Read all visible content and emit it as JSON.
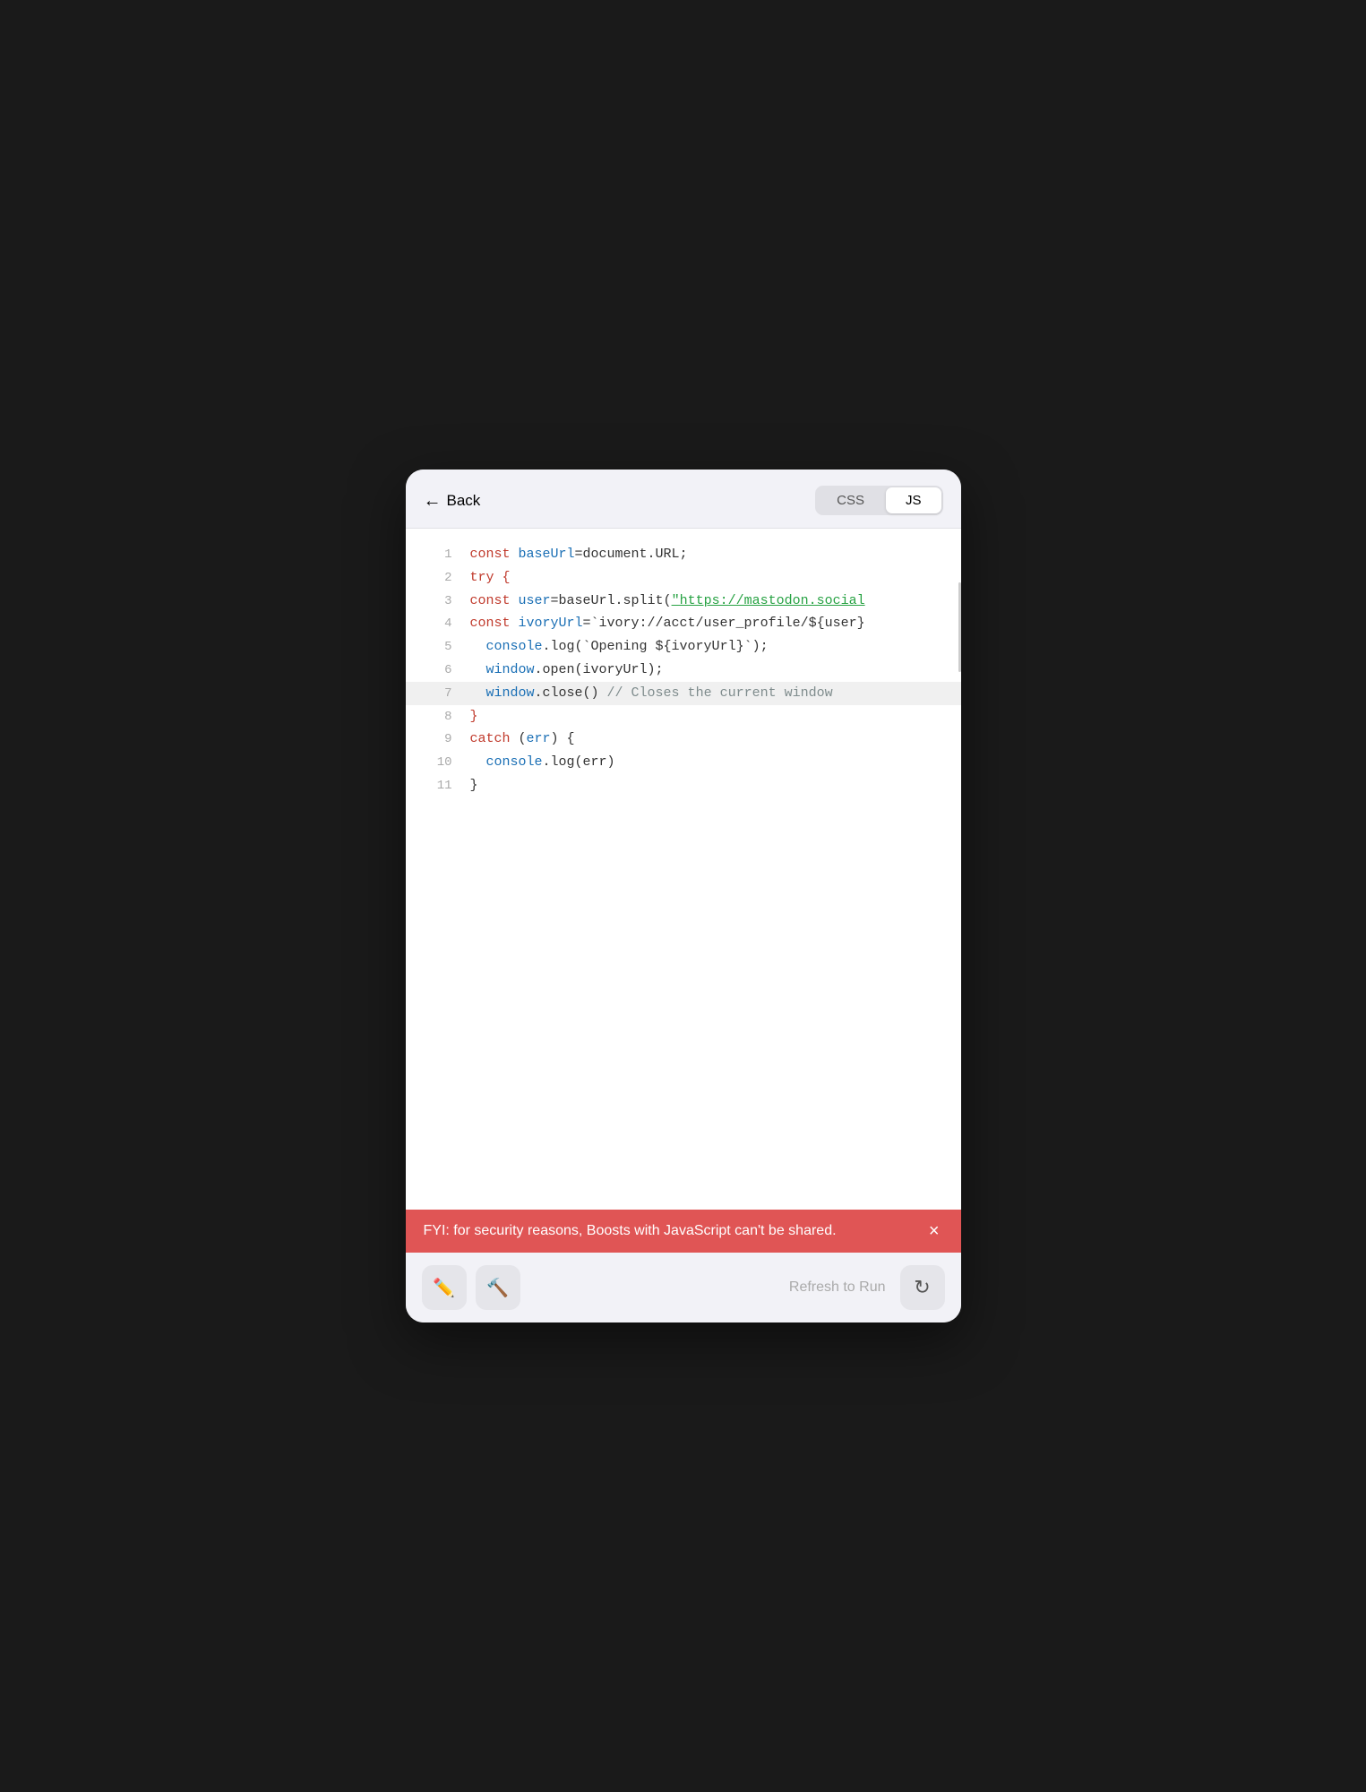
{
  "header": {
    "back_label": "Back",
    "tab_css": "CSS",
    "tab_js": "JS",
    "active_tab": "JS"
  },
  "code": {
    "lines": [
      {
        "num": "1",
        "tokens": [
          {
            "t": "kw-red",
            "v": "const "
          },
          {
            "t": "kw-blue",
            "v": "baseUrl"
          },
          {
            "t": "plain",
            "v": "=document.URL;"
          }
        ]
      },
      {
        "num": "2",
        "tokens": [
          {
            "t": "kw-red",
            "v": "try "
          },
          {
            "t": "brace",
            "v": "{"
          }
        ]
      },
      {
        "num": "3",
        "tokens": [
          {
            "t": "kw-red",
            "v": "const "
          },
          {
            "t": "kw-blue",
            "v": "user"
          },
          {
            "t": "plain",
            "v": "=baseUrl.split("
          },
          {
            "t": "string-green",
            "v": "\"https://mastodon.social"
          },
          {
            "t": "plain",
            "v": ""
          }
        ]
      },
      {
        "num": "4",
        "tokens": [
          {
            "t": "kw-red",
            "v": "const "
          },
          {
            "t": "kw-blue",
            "v": "ivoryUrl"
          },
          {
            "t": "plain",
            "v": "=`ivory://acct/user_profile/${user}"
          }
        ]
      },
      {
        "num": "5",
        "tokens": [
          {
            "t": "plain",
            "v": "  "
          },
          {
            "t": "kw-blue",
            "v": "console"
          },
          {
            "t": "plain",
            "v": ".log(`Opening ${ivoryUrl}`);"
          }
        ]
      },
      {
        "num": "6",
        "tokens": [
          {
            "t": "plain",
            "v": "  "
          },
          {
            "t": "kw-blue",
            "v": "window"
          },
          {
            "t": "plain",
            "v": ".open(ivoryUrl);"
          }
        ]
      },
      {
        "num": "7",
        "tokens": [
          {
            "t": "plain",
            "v": "  "
          },
          {
            "t": "kw-blue",
            "v": "window"
          },
          {
            "t": "plain",
            "v": ".close() "
          },
          {
            "t": "comment",
            "v": "// Closes the current window"
          }
        ],
        "highlighted": true
      },
      {
        "num": "8",
        "tokens": [
          {
            "t": "brace",
            "v": "}"
          }
        ]
      },
      {
        "num": "9",
        "tokens": [
          {
            "t": "kw-red",
            "v": "catch"
          },
          {
            "t": "plain",
            "v": " ("
          },
          {
            "t": "kw-blue",
            "v": "err"
          },
          {
            "t": "plain",
            "v": ") {"
          }
        ]
      },
      {
        "num": "10",
        "tokens": [
          {
            "t": "plain",
            "v": "  "
          },
          {
            "t": "kw-blue",
            "v": "console"
          },
          {
            "t": "plain",
            "v": ".log(err)"
          }
        ]
      },
      {
        "num": "11",
        "tokens": [
          {
            "t": "plain",
            "v": "}"
          }
        ]
      }
    ]
  },
  "warning": {
    "text": "FYI: for security reasons, Boosts with JavaScript can't be shared.",
    "close_label": "×"
  },
  "toolbar": {
    "pencil_icon": "✏",
    "hammer_icon": "🔨",
    "refresh_label": "Refresh to Run",
    "refresh_icon": "↻"
  }
}
